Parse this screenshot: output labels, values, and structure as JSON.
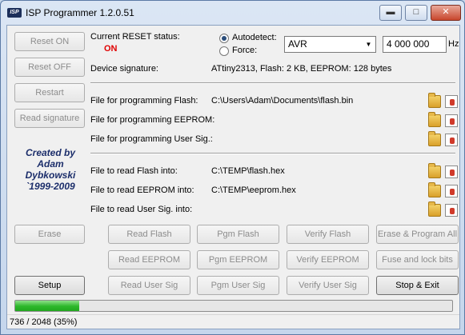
{
  "window": {
    "title": "ISP Programmer 1.2.0.51",
    "app_icon_text": "ISP",
    "icons": {
      "minimize": "minimize-icon",
      "maximize": "maximize-icon",
      "close": "close-icon"
    }
  },
  "left_buttons": {
    "reset_on": "Reset ON",
    "reset_off": "Reset OFF",
    "restart": "Restart",
    "read_signature": "Read signature"
  },
  "reset": {
    "label": "Current RESET status:",
    "value": "ON",
    "value_color": "#e00000"
  },
  "mode": {
    "autodetect_label": "Autodetect:",
    "force_label": "Force:",
    "selected": "autodetect",
    "device_family": "AVR",
    "frequency": "4 000 000",
    "frequency_unit": "Hz"
  },
  "device_signature": {
    "label": "Device signature:",
    "value": "ATtiny2313, Flash: 2 KB, EEPROM: 128 bytes"
  },
  "program_files": [
    {
      "label": "File for programming Flash:",
      "path": "C:\\Users\\Adam\\Documents\\flash.bin"
    },
    {
      "label": "File for programming EEPROM:",
      "path": ""
    },
    {
      "label": "File for programming User Sig.:",
      "path": ""
    }
  ],
  "read_files": [
    {
      "label": "File to read Flash into:",
      "path": "C:\\TEMP\\flash.hex"
    },
    {
      "label": "File to read EEPROM into:",
      "path": "C:\\TEMP\\eeprom.hex"
    },
    {
      "label": "File to read User Sig. into:",
      "path": ""
    }
  ],
  "credits": [
    "Created by",
    "Adam",
    "Dybkowski",
    "`1999-2009"
  ],
  "actions": {
    "erase": "Erase",
    "setup": "Setup",
    "read_flash": "Read Flash",
    "pgm_flash": "Pgm Flash",
    "verify_flash": "Verify Flash",
    "erase_program_all": "Erase & Program All",
    "read_eeprom": "Read EEPROM",
    "pgm_eeprom": "Pgm EEPROM",
    "verify_eeprom": "Verify EEPROM",
    "fuse_lock_bits": "Fuse and lock bits",
    "read_user_sig": "Read User Sig",
    "pgm_user_sig": "Pgm User Sig",
    "verify_user_sig": "Verify User Sig",
    "stop_exit": "Stop & Exit"
  },
  "progress": {
    "fraction": 0.1465,
    "fill_color": "#2cb72a"
  },
  "status": {
    "text": "736 / 2048 (35%)"
  }
}
